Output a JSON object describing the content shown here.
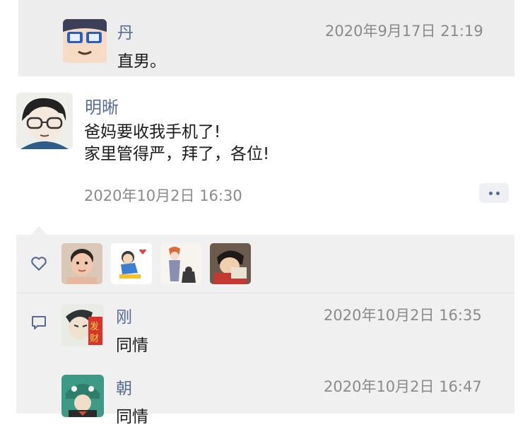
{
  "previous_comment": {
    "author": "丹",
    "time": "2020年9月17日 21:19",
    "text": "直男。"
  },
  "post": {
    "author": "明晰",
    "lines": [
      "爸妈要收我手机了!",
      "家里管得严，拜了，各位!"
    ],
    "time": "2020年10月2日 16:30",
    "more_icon": "more-dots-icon"
  },
  "likes": {
    "icon": "heart-icon",
    "count": 4
  },
  "comments_icon": "comment-icon",
  "comments": [
    {
      "author": "刚",
      "time": "2020年10月2日 16:35",
      "text": "同情"
    },
    {
      "author": "朝",
      "time": "2020年10月2日 16:47",
      "text": "同情"
    }
  ],
  "colors": {
    "name": "#576b95",
    "panel": "#f0f0f0",
    "timestamp": "#8a8a8a"
  }
}
